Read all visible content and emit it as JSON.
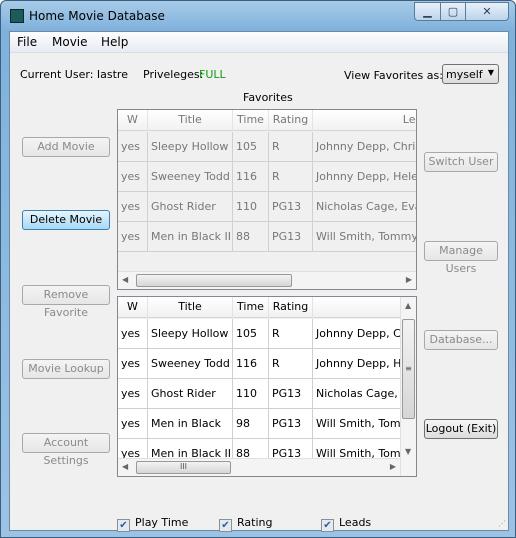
{
  "window": {
    "title": "Home Movie Database",
    "minimize": "▁",
    "maximize": "▢",
    "close": "✕"
  },
  "menu": [
    "File",
    "Movie",
    "Help"
  ],
  "user": {
    "label": "Current User: Iastre",
    "priv_label": "Priveleges:",
    "priv_value": "FULL",
    "priv_color": "#119911"
  },
  "view_as": {
    "label": "View Favorites as:",
    "value": "myself"
  },
  "favorites_label": "Favorites",
  "left_buttons": [
    {
      "label": "Add Movie",
      "enabled": false
    },
    {
      "label": "Delete Movie",
      "enabled": true,
      "focused": true
    },
    {
      "label": "Remove Favorite",
      "enabled": false
    },
    {
      "label": "Movie Lookup",
      "enabled": false
    },
    {
      "label": "Account Settings",
      "enabled": false
    }
  ],
  "right_buttons": [
    {
      "label": "Switch User",
      "enabled": false
    },
    {
      "label": "Manage Users",
      "enabled": false
    },
    {
      "label": "Database...",
      "enabled": false
    },
    {
      "label": "Logout (Exit)",
      "enabled": true
    }
  ],
  "fav_table": {
    "columns": [
      "W",
      "Title",
      "Time",
      "Rating",
      "Lea"
    ],
    "rows": [
      [
        "yes",
        "Sleepy Hollow",
        "105",
        "R",
        "Johnny Depp, Chris"
      ],
      [
        "yes",
        "Sweeney Todd",
        "116",
        "R",
        "Johnny Depp, Hele"
      ],
      [
        "yes",
        "Ghost Rider",
        "110",
        "PG13",
        "Nicholas Cage, Eva"
      ],
      [
        "yes",
        "Men in Black II",
        "88",
        "PG13",
        "Will Smith, Tommy"
      ]
    ]
  },
  "movie_table": {
    "columns": [
      "W",
      "Title",
      "Time",
      "Rating",
      ""
    ],
    "rows": [
      [
        "yes",
        "Sleepy Hollow",
        "105",
        "R",
        "Johnny Depp, C"
      ],
      [
        "yes",
        "Sweeney Todd",
        "116",
        "R",
        "Johnny Depp, H"
      ],
      [
        "yes",
        "Ghost Rider",
        "110",
        "PG13",
        "Nicholas Cage, E"
      ],
      [
        "yes",
        "Men in Black",
        "98",
        "PG13",
        "Will Smith, Tom"
      ],
      [
        "yes",
        "Men in Black II",
        "88",
        "PG13",
        "Will Smith, Tom"
      ]
    ]
  },
  "checkboxes": [
    {
      "label": "Play Time",
      "checked": true
    },
    {
      "label": "Rating",
      "checked": true
    },
    {
      "label": "Leads",
      "checked": true
    }
  ]
}
